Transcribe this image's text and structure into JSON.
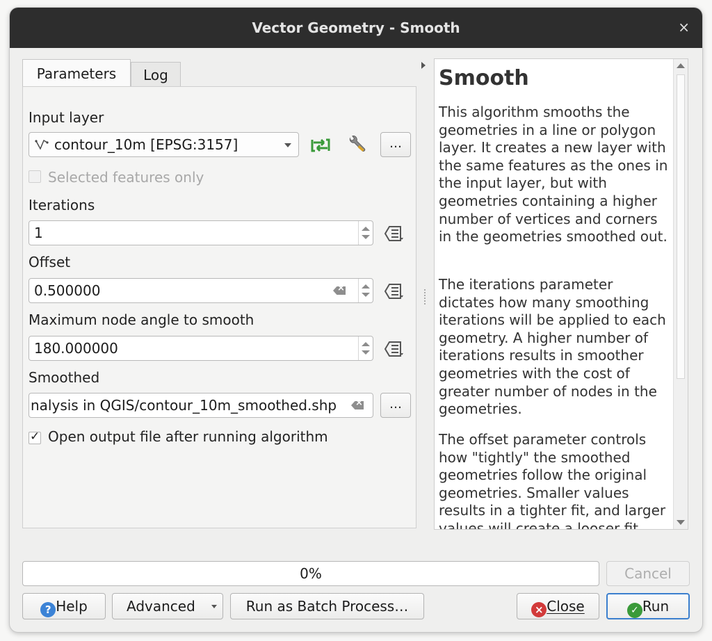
{
  "window": {
    "title": "Vector Geometry - Smooth",
    "close_glyph": "×"
  },
  "tabs": [
    {
      "label": "Parameters"
    },
    {
      "label": "Log"
    }
  ],
  "params": {
    "input_layer": {
      "label": "Input layer",
      "value": "contour_10m [EPSG:3157]"
    },
    "selected_only": {
      "label": "Selected features only",
      "checked": false,
      "enabled": false
    },
    "iterations": {
      "label": "Iterations",
      "value": "1"
    },
    "offset": {
      "label": "Offset",
      "value": "0.500000"
    },
    "max_angle": {
      "label": "Maximum node angle to smooth",
      "value": "180.000000"
    },
    "smoothed": {
      "label": "Smoothed",
      "value": "nalysis in QGIS/contour_10m_smoothed.shp"
    },
    "open_output": {
      "label": "Open output file after running algorithm",
      "checked": true
    },
    "ellipsis": "…"
  },
  "help": {
    "title": "Smooth",
    "paragraphs": [
      "This algorithm smooths the geometries in a line or polygon layer. It creates a new layer with the same features as the ones in the input layer, but with geometries containing a higher number of vertices and corners in the geometries smoothed out.",
      "The iterations parameter dictates how many smoothing iterations will be applied to each geometry. A higher number of iterations results in smoother geometries with the cost of greater number of nodes in the geometries.",
      "The offset parameter controls how \"tightly\" the smoothed geometries follow the original geometries. Smaller values results in a tighter fit, and larger values will create a looser fit."
    ]
  },
  "progress": {
    "value": 0,
    "label": "0%"
  },
  "buttons": {
    "cancel": "Cancel",
    "help": "Help",
    "advanced": "Advanced",
    "batch": "Run as Batch Process…",
    "close": "Close",
    "run": "Run"
  },
  "colors": {
    "accent": "#4a90d9",
    "run_border": "#3b7fce",
    "green": "#3a9a3a",
    "red": "#d23a3a",
    "help_blue": "#3c83d6"
  }
}
